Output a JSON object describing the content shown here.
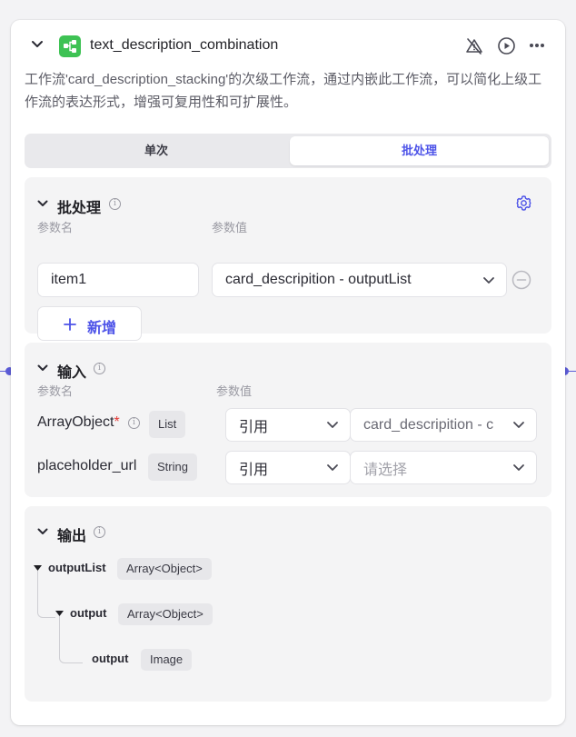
{
  "node": {
    "title": "text_description_combination",
    "description": "工作流'card_description_stacking'的次级工作流，通过内嵌此工作流，可以简化上级工作流的表达形式，增强可复用性和可扩展性。",
    "icons": [
      "chevron-down-icon",
      "workflow-icon",
      "alert-off-icon",
      "play-icon",
      "more-icon"
    ]
  },
  "tabs": [
    {
      "label": "单次",
      "active": false
    },
    {
      "label": "批处理",
      "active": true
    }
  ],
  "batch": {
    "title": "批处理",
    "col_name": "参数名",
    "col_value": "参数值",
    "param_name": "item1",
    "param_value": "card_descripition - outputList",
    "add_label": "新增"
  },
  "input": {
    "title": "输入",
    "col_name": "参数名",
    "col_value": "参数值",
    "rows": [
      {
        "name": "ArrayObject",
        "required": "*",
        "type": "List",
        "mode": "引用",
        "value": "card_descripition - c"
      },
      {
        "name": "placeholder_url",
        "required": "",
        "type": "String",
        "mode": "引用",
        "placeholder": "请选择"
      }
    ]
  },
  "output": {
    "title": "输出",
    "tree": [
      {
        "name": "outputList",
        "type": "Array<Object>"
      },
      {
        "name": "output",
        "type": "Array<Object>"
      },
      {
        "name": "output",
        "type": "Image"
      }
    ]
  },
  "colors": {
    "accent": "#4d53e8",
    "connector": "#5b5bd6",
    "node_icon": "#3ec254",
    "danger": "#e53935"
  }
}
